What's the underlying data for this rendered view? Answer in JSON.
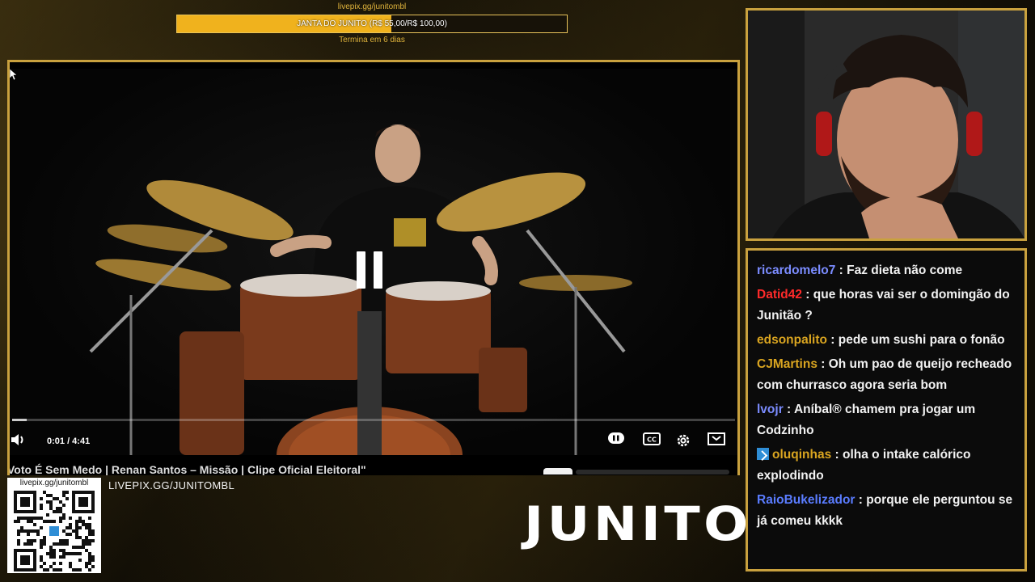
{
  "goal": {
    "url": "livepix.gg/junitombl",
    "label": "JANTA DO JUNITO (R$ 55,00/R$ 100,00)",
    "progress_fraction": 0.55,
    "ends": "Termina em 6 dias"
  },
  "player": {
    "time": "0:01 / 4:41",
    "progress_fraction": 0.02,
    "title": "Voto É Sem Medo | Renan Santos – Missão | Clipe Oficial Eleitoral\"",
    "icons": {
      "volume": "volume-icon",
      "pause_small": "pause-icon",
      "captions": "closed-captions-icon",
      "settings": "settings-gear-icon",
      "miniplayer": "miniplayer-icon",
      "center_pause": "pause-icon"
    }
  },
  "overlay": {
    "qr_url": "livepix.gg/junitombl",
    "livepix_label": "LIVEPIX.GG/JUNITOMBL",
    "logo_text": "JUNITO"
  },
  "chat": {
    "messages": [
      {
        "user": "ricardomelo7",
        "color": "#7b8cff",
        "text": "Faz dieta não come"
      },
      {
        "user": "Datid42",
        "color": "#ff2a2a",
        "text": "que horas vai ser o domingão do Junitão ?"
      },
      {
        "user": "edsonpalito",
        "color": "#daa520",
        "text": "pede um sushi para o fonão"
      },
      {
        "user": "CJMartins",
        "color": "#daa520",
        "text": "Oh um pao de queijo recheado com churrasco agora seria bom"
      },
      {
        "user": "lvojr",
        "color": "#7b8cff",
        "text": "Aníbal® chamem pra jogar um Codzinho"
      },
      {
        "user": "oluqinhas",
        "color": "#daa520",
        "text": "olha o intake calórico explodindo",
        "badge": true
      },
      {
        "user": "RaioBukelizador",
        "color": "#5a7cff",
        "text": "porque ele perguntou se já comeu kkkk"
      }
    ]
  },
  "colors": {
    "accent_gold": "#c9a13e",
    "goal_fill": "#f0b21d"
  }
}
